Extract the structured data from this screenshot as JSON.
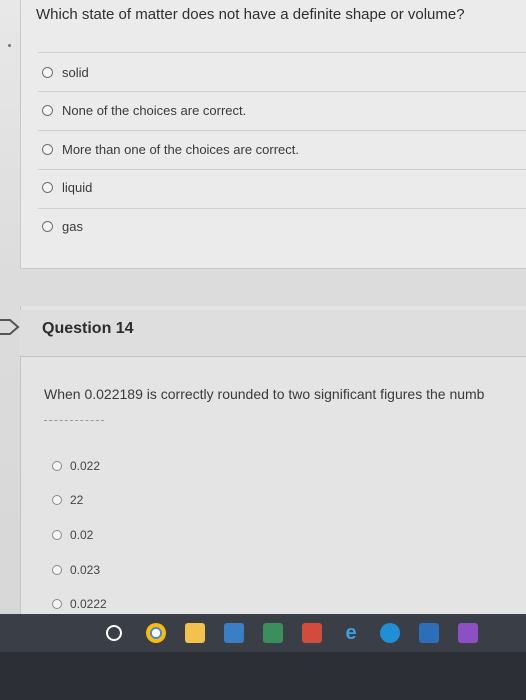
{
  "question13": {
    "text": "Which state of matter does not have a definite shape or volume?",
    "options": [
      "solid",
      "None of the choices are correct.",
      "More than one of the choices are correct.",
      "liquid",
      "gas"
    ]
  },
  "question14": {
    "title": "Question 14",
    "text": "When 0.022189 is correctly rounded to two significant figures the numb",
    "options": [
      "0.022",
      "22",
      "0.02",
      "0.023",
      "0.0222"
    ]
  },
  "taskbar": {
    "icons": [
      "search-icon",
      "chrome-icon",
      "file-explorer-icon",
      "calendar-icon",
      "excel-icon",
      "outlook-icon",
      "edge-icon",
      "ie-icon",
      "app-store-icon",
      "photos-icon"
    ]
  }
}
